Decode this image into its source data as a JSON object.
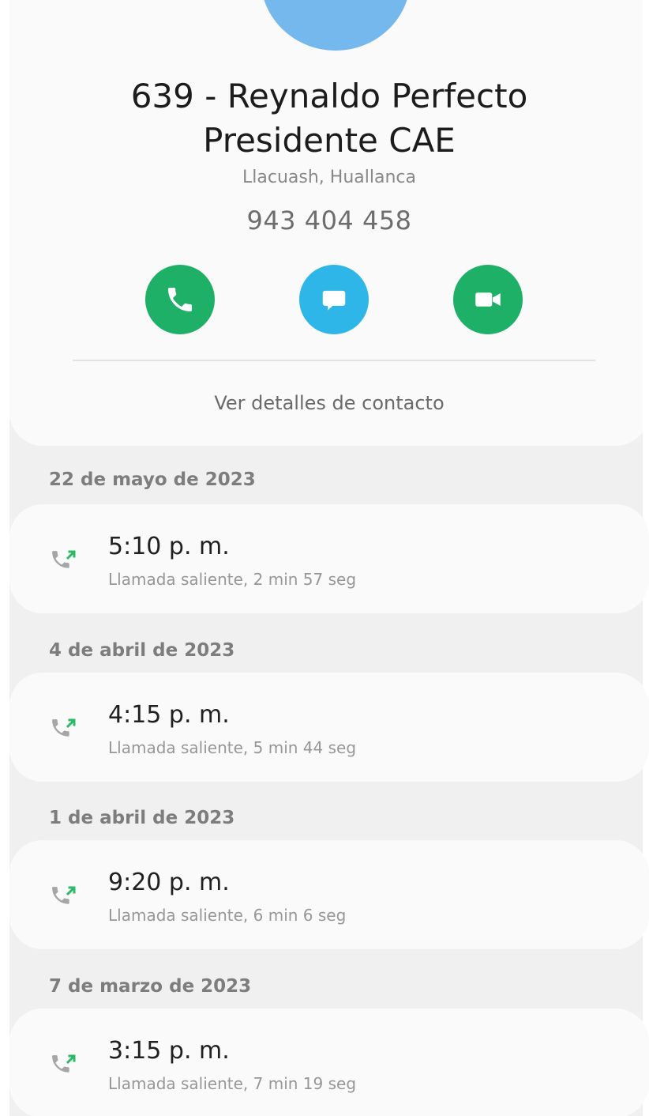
{
  "contact": {
    "name_line1": "639 - Reynaldo Perfecto",
    "name_line2": "Presidente CAE",
    "location": "Llacuash, Huallanca",
    "phone": "943 404 458",
    "avatar_color": "#74b8ee"
  },
  "actions": [
    {
      "name": "call",
      "icon": "phone-icon",
      "color": "#1fb067"
    },
    {
      "name": "message",
      "icon": "message-icon",
      "color": "#2fb6e8"
    },
    {
      "name": "video",
      "icon": "video-icon",
      "color": "#1fb067"
    }
  ],
  "details_link": "Ver detalles de contacto",
  "call_log": [
    {
      "date": "22 de mayo de 2023",
      "time": "5:10 p. m.",
      "description": "Llamada saliente, 2 min 57 seg",
      "icon": "outgoing-call-icon"
    },
    {
      "date": "4 de abril de 2023",
      "time": "4:15 p. m.",
      "description": "Llamada saliente, 5 min 44 seg",
      "icon": "outgoing-call-icon"
    },
    {
      "date": "1 de abril de 2023",
      "time": "9:20 p. m.",
      "description": "Llamada saliente, 6 min 6 seg",
      "icon": "outgoing-call-icon"
    },
    {
      "date": "7 de marzo de 2023",
      "time": "3:15 p. m.",
      "description": "Llamada saliente, 7 min 19 seg",
      "icon": "outgoing-call-icon"
    }
  ]
}
